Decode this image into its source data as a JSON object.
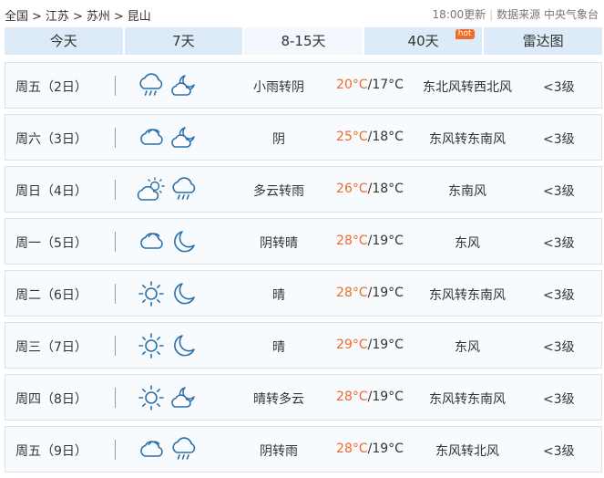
{
  "breadcrumb": {
    "items": [
      "全国",
      "江苏",
      "苏州",
      "昆山"
    ],
    "sep": ">"
  },
  "source": {
    "update_time": "18:00更新",
    "label": "数据来源 中央气象台"
  },
  "tabs": [
    {
      "label": "今天",
      "active": false
    },
    {
      "label": "7天",
      "active": false
    },
    {
      "label": "8-15天",
      "active": true
    },
    {
      "label": "40天",
      "active": false,
      "badge": "hot"
    },
    {
      "label": "雷达图",
      "active": false
    }
  ],
  "colors": {
    "accent": "#f06a28",
    "tab_bg": "#dcebf7",
    "row_border": "#d7e4ef"
  },
  "days": [
    {
      "day": "周五（2日）",
      "icons": [
        "cloud-rain-icon",
        "moon-cloud-icon"
      ],
      "desc": "小雨转阴",
      "high": "20°C",
      "low": "/17°C",
      "wind": "东北风转西北风",
      "level": "<3级"
    },
    {
      "day": "周六（3日）",
      "icons": [
        "cloud-overcast-icon",
        "moon-cloud-icon"
      ],
      "desc": "阴",
      "high": "25°C",
      "low": "/18°C",
      "wind": "东风转东南风",
      "level": "<3级"
    },
    {
      "day": "周日（4日）",
      "icons": [
        "sun-cloud-icon",
        "cloud-rain-icon"
      ],
      "desc": "多云转雨",
      "high": "26°C",
      "low": "/18°C",
      "wind": "东南风",
      "level": "<3级"
    },
    {
      "day": "周一（5日）",
      "icons": [
        "cloud-overcast-icon",
        "moon-icon"
      ],
      "desc": "阴转晴",
      "high": "28°C",
      "low": "/19°C",
      "wind": "东风",
      "level": "<3级"
    },
    {
      "day": "周二（6日）",
      "icons": [
        "sun-icon",
        "moon-icon"
      ],
      "desc": "晴",
      "high": "28°C",
      "low": "/19°C",
      "wind": "东风转东南风",
      "level": "<3级"
    },
    {
      "day": "周三（7日）",
      "icons": [
        "sun-icon",
        "moon-icon"
      ],
      "desc": "晴",
      "high": "29°C",
      "low": "/19°C",
      "wind": "东风",
      "level": "<3级"
    },
    {
      "day": "周四（8日）",
      "icons": [
        "sun-icon",
        "moon-cloud-icon"
      ],
      "desc": "晴转多云",
      "high": "28°C",
      "low": "/19°C",
      "wind": "东风转东南风",
      "level": "<3级"
    },
    {
      "day": "周五（9日）",
      "icons": [
        "cloud-overcast-icon",
        "cloud-rain-icon"
      ],
      "desc": "阴转雨",
      "high": "28°C",
      "low": "/19°C",
      "wind": "东风转北风",
      "level": "<3级"
    }
  ]
}
